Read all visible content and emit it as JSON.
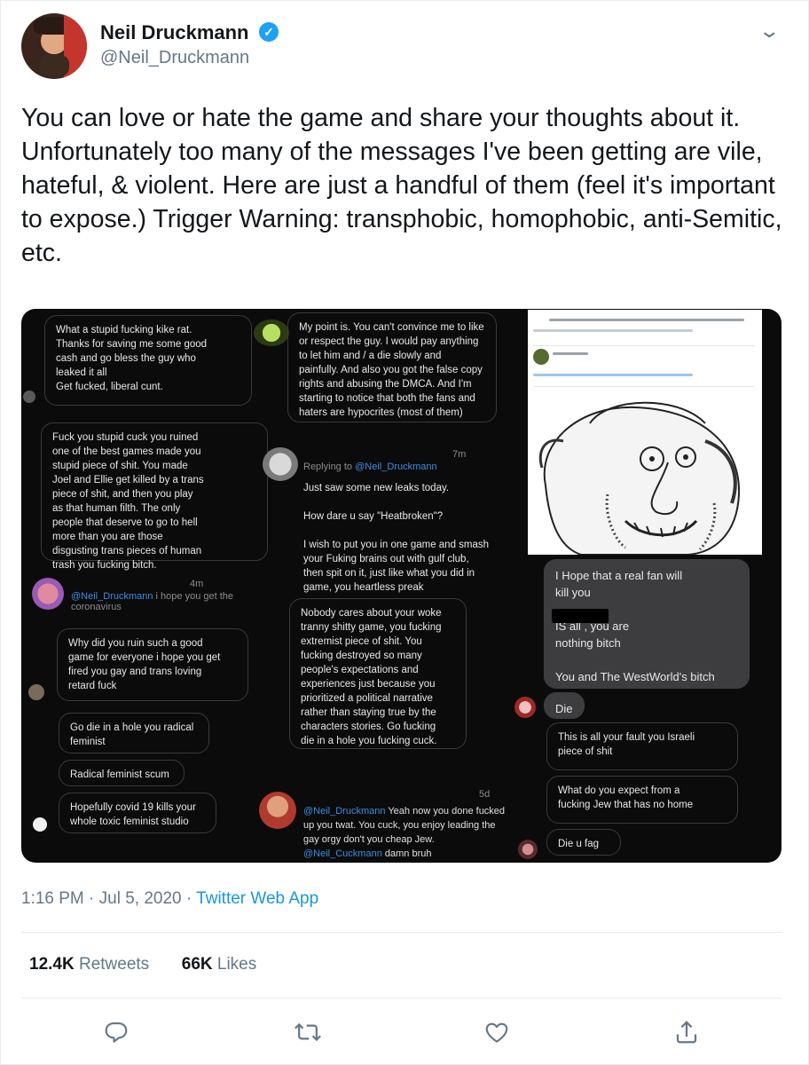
{
  "author": {
    "name": "Neil Druckmann",
    "handle": "@Neil_Druckmann",
    "verified_mark": "✓"
  },
  "tweet": {
    "text": "You can love or hate the game and share your thoughts about it. Unfortunately too many of the messages I've been getting are vile, hateful, & violent. Here are just a handful of them (feel it's important to expose.) Trigger Warning: transphobic, homophobic, anti-Semitic, etc.",
    "time": "1:16 PM",
    "date": "Jul 5, 2020",
    "source": "Twitter Web App",
    "separator": "·"
  },
  "stats": {
    "retweets_count": "12.4K",
    "retweets_label": "Retweets",
    "likes_count": "66K",
    "likes_label": "Likes"
  },
  "media": {
    "messages": [
      "What a stupid fucking kike rat.\nThanks for saving me some good\ncash and go bless the guy who\nleaked it all\nGet fucked, liberal cunt.",
      "Fuck you stupid cuck you ruined\none of the best games made you\nstupid piece of shit. You made\nJoel and Ellie get killed by a trans\npiece of shit, and then you play\nas that human filth. The only\npeople that deserve to go to hell\nmore than you are those\ndisgusting trans pieces of human\ntrash you fucking bitch.",
      "Why did you ruin such a good\ngame for everyone i hope you get\nfired you gay and trans loving\nretard fuck",
      "Go die in a hole you radical\nfeminist",
      "Radical feminist scum",
      "Hopefully covid 19 kills your\nwhole toxic feminist studio",
      "My point is. You can't convince me to like\nor respect the guy. I would pay anything\nto let him and /   a die slowly and\npainfully. And also you got the false copy\nrights and abusing the DMCA. And I'm\nstarting to notice that both the fans and\nhaters are hypocrites (most of them)",
      "Just saw some new leaks today.\n\nHow dare u say \"Heatbroken\"?\n\nI wish to put you in one game and smash\nyour Fuking brains out with gulf club,\nthen spit on it, just like what you did in\ngame, you heartless preak",
      "Nobody cares about your woke\ntranny shitty game, you fucking\nextremist piece of shit. You\nfucking destroyed so many\npeople's expectations and\nexperiences just because you\nprioritized a political narrative\nrather than staying true by the\ncharacters stories. Go fucking\ndie in a hole you fucking cuck.",
      "I Hope that a real fan will\nkill you\n\nIS all , you are\nnothing bitch\n\nYou and The WestWorld's bitch",
      "Die",
      "This is all your fault you Israeli\npiece of shit",
      "What do you expect from a\nfucking Jew that has no home",
      "Die u fag"
    ],
    "reply_mention": "@Neil_Druckmann",
    "reply_mention_alt": "@Neil_Cuckmann",
    "replying_to_label": "Replying to",
    "corona_reply": "i hope you get the coronavirus",
    "bottom_reply_1": "Yeah now you done fucked up you twat. You cuck, you enjoy leading the gay orgy don't you cheap Jew.",
    "bottom_reply_2": "damn bruh",
    "time_4m": "4m",
    "time_7m": "7m",
    "time_5d": "5d"
  },
  "icons": {
    "menu": "chevron-down-icon",
    "reply": "reply-icon",
    "retweet": "retweet-icon",
    "like": "like-icon",
    "share": "share-icon"
  },
  "colors": {
    "accent": "#1da1f2",
    "link": "#1b95e0",
    "secondary_text": "#657786"
  }
}
